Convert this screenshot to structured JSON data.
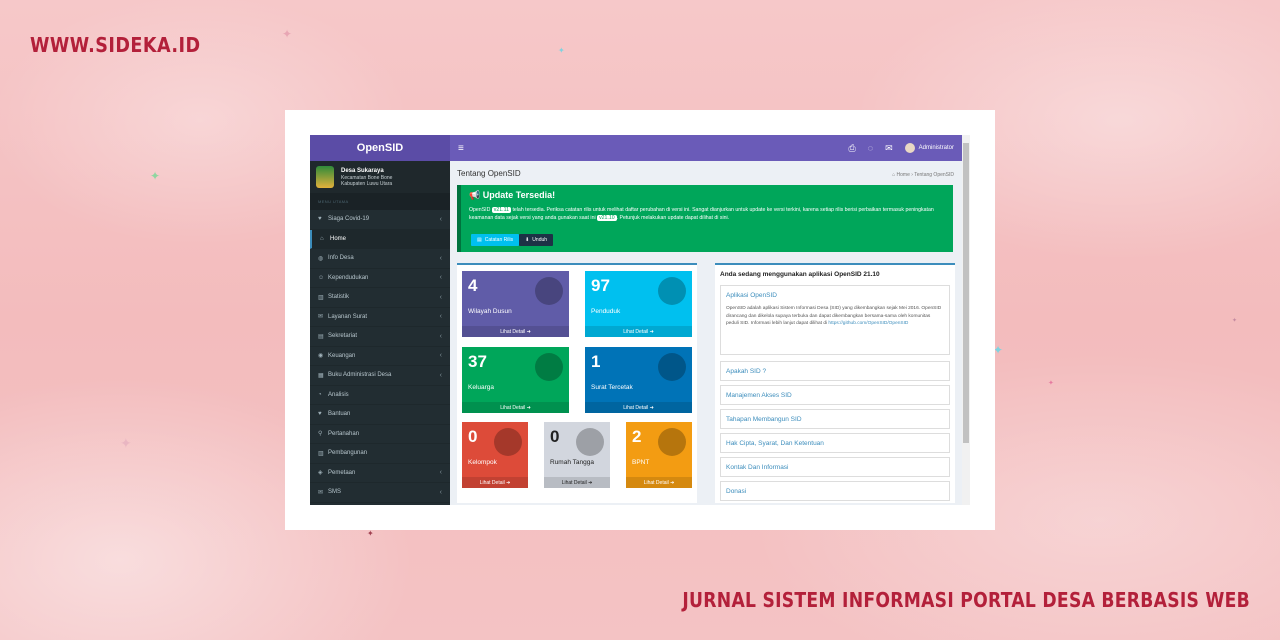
{
  "site_url": "WWW.SIDEKA.ID",
  "caption": "JURNAL SISTEM INFORMASI PORTAL DESA BERBASIS WEB",
  "colors": {
    "accent_red": "#b3203a",
    "purple": "#6a5bb8",
    "green": "#00a65a",
    "sidebar": "#222d32"
  },
  "app": {
    "brand": "OpenSID",
    "navbar": {
      "toggle_icon": "hamburger-icon",
      "icons": [
        "printer-icon",
        "chat-icon",
        "mail-icon"
      ],
      "user_name": "Administrator"
    },
    "village": {
      "name": "Desa Sukaraya",
      "line2": "Kecamatan Bone Bone",
      "line3": "Kabupaten Luwu Utara"
    },
    "menu_header": "MENU UTAMA",
    "menu": [
      {
        "label": "Siaga Covid-19",
        "icon": "heartbeat-icon",
        "arrow": "‹"
      },
      {
        "label": "Home",
        "icon": "home-icon",
        "arrow": "",
        "active": true
      },
      {
        "label": "Info Desa",
        "icon": "globe-icon",
        "arrow": "‹"
      },
      {
        "label": "Kependudukan",
        "icon": "users-icon",
        "arrow": "‹"
      },
      {
        "label": "Statistik",
        "icon": "chart-icon",
        "arrow": "‹"
      },
      {
        "label": "Layanan Surat",
        "icon": "envelope-icon",
        "arrow": "‹"
      },
      {
        "label": "Sekretariat",
        "icon": "archive-icon",
        "arrow": "‹"
      },
      {
        "label": "Keuangan",
        "icon": "money-icon",
        "arrow": "‹"
      },
      {
        "label": "Buku Administrasi Desa",
        "icon": "book-icon",
        "arrow": "‹"
      },
      {
        "label": "Analisis",
        "icon": "analysis-icon",
        "arrow": ""
      },
      {
        "label": "Bantuan",
        "icon": "heart-icon",
        "arrow": ""
      },
      {
        "label": "Pertanahan",
        "icon": "map-pin-icon",
        "arrow": ""
      },
      {
        "label": "Pembangunan",
        "icon": "building-icon",
        "arrow": ""
      },
      {
        "label": "Pemetaan",
        "icon": "map-icon",
        "arrow": "‹"
      },
      {
        "label": "SMS",
        "icon": "sms-icon",
        "arrow": "‹"
      }
    ],
    "content": {
      "title": "Tentang OpenSID",
      "breadcrumb_home": "Home",
      "breadcrumb_current": "Tentang OpenSID",
      "update": {
        "title": "Update Tersedia!",
        "text_pre": "OpenSID",
        "version_new": "v21.11",
        "text_mid": "telah tersedia. Periksa catatan rilis untuk melihat daftar perubahan di versi ini. Sangat dianjurkan untuk update ke versi terkini, karena setiap rilis berisi perbaikan termasuk peningkatan keamanan data sejak versi yang anda gunakan saat ini",
        "version_current": "v21.10",
        "text_post": ". Petunjuk melakukan update dapat dilihat di sini.",
        "btn_notes": "Catatan Rilis",
        "btn_download": "Unduh"
      },
      "tiles": [
        {
          "value": "4",
          "label": "Wilayah Dusun",
          "link": "Lihat Detail ➜",
          "color": "#605ca8"
        },
        {
          "value": "97",
          "label": "Penduduk",
          "link": "Lihat Detail ➜",
          "color": "#00c0ef"
        },
        {
          "value": "37",
          "label": "Keluarga",
          "link": "Lihat Detail ➜",
          "color": "#00a65a"
        },
        {
          "value": "1",
          "label": "Surat Tercetak",
          "link": "Lihat Detail ➜",
          "color": "#0073b7"
        },
        {
          "value": "0",
          "label": "Kelompok",
          "link": "Lihat Detail ➜",
          "color": "#dd4b39"
        },
        {
          "value": "0",
          "label": "Rumah Tangga",
          "link": "Lihat Detail ➜",
          "color": "#d2d6de"
        },
        {
          "value": "2",
          "label": "BPNT",
          "link": "Lihat Detail ➜",
          "color": "#f39c12"
        }
      ],
      "info": {
        "heading": "Anda sedang menggunakan aplikasi OpenSID 21.10",
        "panels": [
          {
            "title": "Aplikasi OpenSID",
            "body": "OpenSID adalah aplikasi Sistem Informasi Desa (SID) yang dikembangkan sejak Mei 2016. OpenSID dirancang dan dikelola supaya terbuka dan dapat dikembangkan bersama-sama oleh komunitas peduli SID. Informasi lebih lanjut dapat dilihat di",
            "link": "https://github.com/OpenSID/OpenSID"
          },
          {
            "title": "Apakah SID ?"
          },
          {
            "title": "Manajemen Akses SID"
          },
          {
            "title": "Tahapan Membangun SID"
          },
          {
            "title": "Hak Cipta, Syarat, Dan Ketentuan"
          },
          {
            "title": "Kontak Dan Informasi"
          },
          {
            "title": "Donasi"
          }
        ]
      }
    }
  }
}
